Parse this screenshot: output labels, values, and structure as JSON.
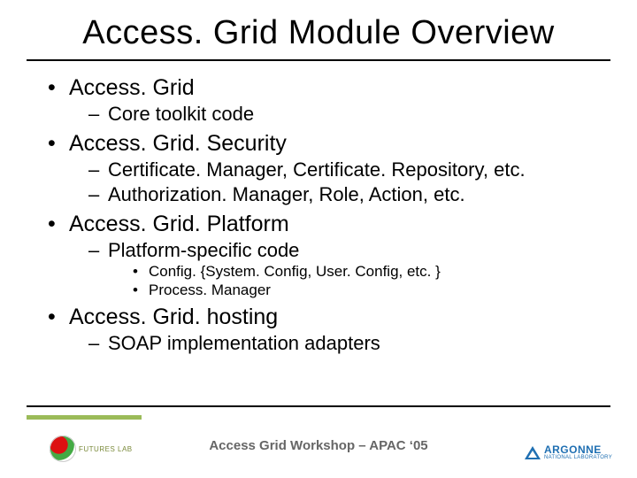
{
  "title": "Access. Grid Module Overview",
  "bullets": {
    "b0": {
      "label": "Access. Grid",
      "subs": {
        "s0": "Core toolkit code"
      }
    },
    "b1": {
      "label": "Access. Grid. Security",
      "subs": {
        "s0": "Certificate. Manager, Certificate. Repository, etc.",
        "s1": "Authorization. Manager, Role, Action, etc."
      }
    },
    "b2": {
      "label": "Access. Grid. Platform",
      "subs": {
        "s0": "Platform-specific code"
      },
      "subsubs": {
        "t0": "Config. {System. Config, User. Config, etc. }",
        "t1": "Process. Manager"
      }
    },
    "b3": {
      "label": "Access. Grid. hosting",
      "subs": {
        "s0": "SOAP implementation adapters"
      }
    }
  },
  "footer": "Access Grid Workshop – APAC ‘05",
  "logos": {
    "left_text": "FUTURES LAB",
    "right_top": "ARGONNE",
    "right_bottom": "NATIONAL LABORATORY"
  }
}
